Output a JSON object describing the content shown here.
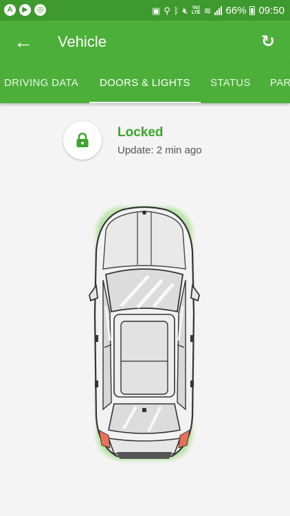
{
  "status_bar": {
    "battery": "66%",
    "time": "09:50",
    "volte": "Vo)\nLTE"
  },
  "app_bar": {
    "title": "Vehicle"
  },
  "tabs": [
    {
      "label": "DRIVING DATA"
    },
    {
      "label": "DOORS & LIGHTS",
      "active": true
    },
    {
      "label": "STATUS"
    },
    {
      "label": "PAR"
    }
  ],
  "lock": {
    "status": "Locked",
    "update": "Update: 2 min ago"
  },
  "colors": {
    "status_bar": "#3e9a2e",
    "app_bar": "#4caf3a",
    "accent_green": "#3aa52d"
  },
  "icons": {
    "back": "arrow-left-icon",
    "refresh": "refresh-icon",
    "lock": "lock-icon",
    "car": "car-top-view"
  }
}
